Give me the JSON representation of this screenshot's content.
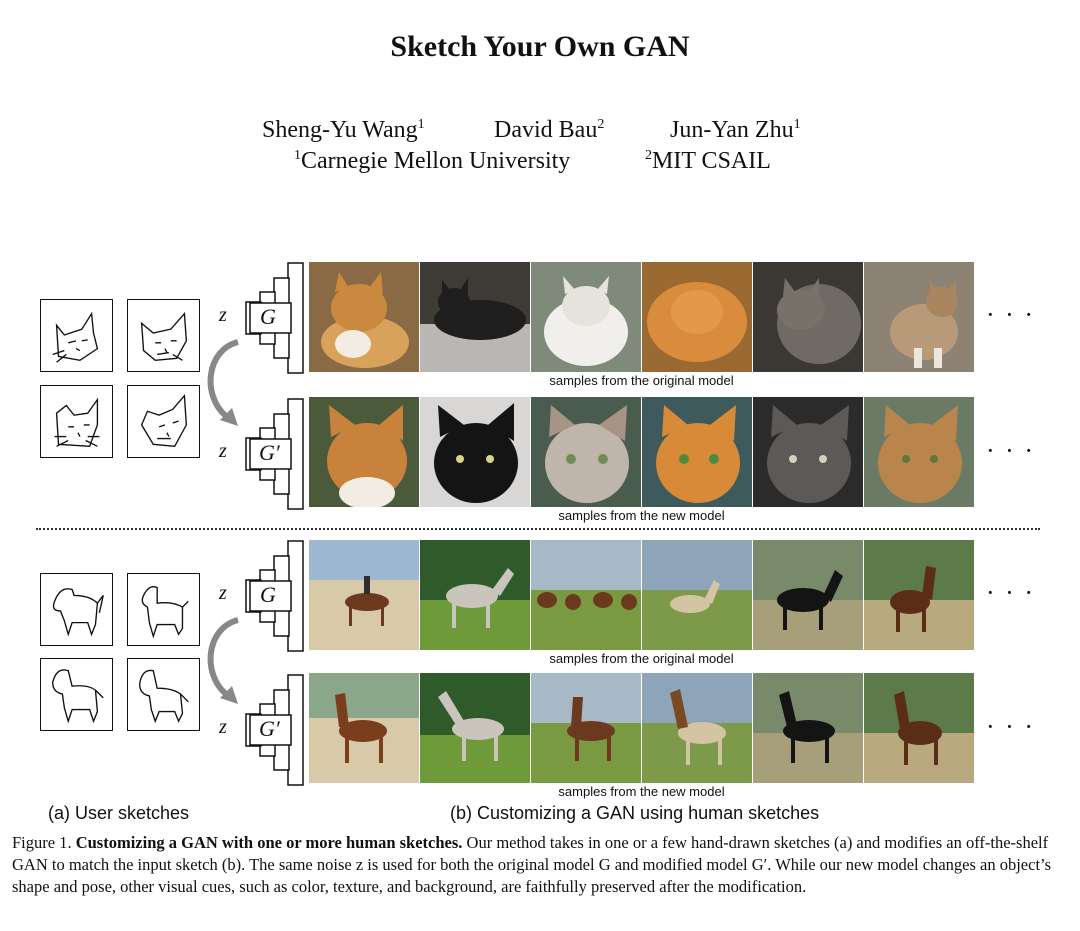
{
  "paper": {
    "title": "Sketch Your Own GAN",
    "authors": [
      {
        "name": "Sheng-Yu Wang",
        "sup": "1"
      },
      {
        "name": "David Bau",
        "sup": "2"
      },
      {
        "name": "Jun-Yan Zhu",
        "sup": "1"
      }
    ],
    "affiliations": [
      {
        "sup": "1",
        "name": "Carnegie Mellon University"
      },
      {
        "sup": "2",
        "name": "MIT CSAIL"
      }
    ]
  },
  "figure": {
    "rows": [
      {
        "label": "samples from the original model",
        "generator": "G"
      },
      {
        "label": "samples from the new model",
        "generator": "G′"
      },
      {
        "label": "samples from the original model",
        "generator": "G"
      },
      {
        "label": "samples from the new model",
        "generator": "G′"
      }
    ],
    "noise_label": "z",
    "ellipsis": "· · ·",
    "subcaption_a": "(a) User sketches",
    "subcaption_b": "(b) Customizing a GAN using human sketches"
  },
  "caption": {
    "prefix": "Figure 1. ",
    "bold": "Customizing a GAN with one or more human sketches.",
    "text": " Our method takes in one or a few hand-drawn sketches (a) and modifies an off-the-shelf GAN to match the input sketch (b). The same noise z is used for both the original model G and modified model G′. While our new model changes an object’s shape and pose, other visual cues, such as color, texture, and background, are faithfully preserved after the modification."
  },
  "colors": {
    "cat_orange": "#c98a3f",
    "cat_black": "#1e1e1e",
    "cat_white": "#e8e4de",
    "cat_gray": "#6f6a64",
    "grass": "#6f9a3a",
    "sand": "#d8c9a8",
    "horse_brown": "#6b3a1e",
    "horse_black": "#141414",
    "horse_gray": "#c9c5bd"
  }
}
